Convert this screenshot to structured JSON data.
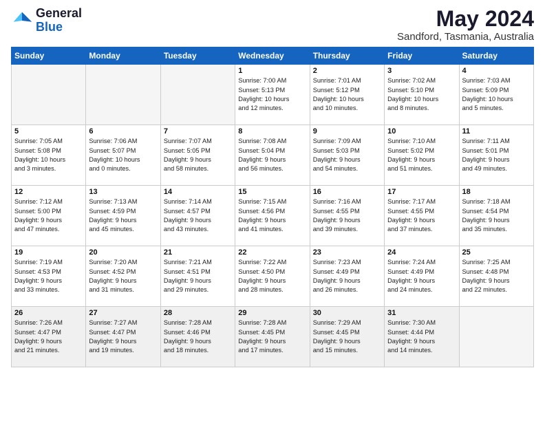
{
  "header": {
    "logo_general": "General",
    "logo_blue": "Blue",
    "month_year": "May 2024",
    "location": "Sandford, Tasmania, Australia"
  },
  "days_of_week": [
    "Sunday",
    "Monday",
    "Tuesday",
    "Wednesday",
    "Thursday",
    "Friday",
    "Saturday"
  ],
  "weeks": [
    [
      {
        "day": "",
        "empty": true,
        "info": ""
      },
      {
        "day": "",
        "empty": true,
        "info": ""
      },
      {
        "day": "",
        "empty": true,
        "info": ""
      },
      {
        "day": "1",
        "empty": false,
        "info": "Sunrise: 7:00 AM\nSunset: 5:13 PM\nDaylight: 10 hours\nand 12 minutes."
      },
      {
        "day": "2",
        "empty": false,
        "info": "Sunrise: 7:01 AM\nSunset: 5:12 PM\nDaylight: 10 hours\nand 10 minutes."
      },
      {
        "day": "3",
        "empty": false,
        "info": "Sunrise: 7:02 AM\nSunset: 5:10 PM\nDaylight: 10 hours\nand 8 minutes."
      },
      {
        "day": "4",
        "empty": false,
        "info": "Sunrise: 7:03 AM\nSunset: 5:09 PM\nDaylight: 10 hours\nand 5 minutes."
      }
    ],
    [
      {
        "day": "5",
        "empty": false,
        "info": "Sunrise: 7:05 AM\nSunset: 5:08 PM\nDaylight: 10 hours\nand 3 minutes."
      },
      {
        "day": "6",
        "empty": false,
        "info": "Sunrise: 7:06 AM\nSunset: 5:07 PM\nDaylight: 10 hours\nand 0 minutes."
      },
      {
        "day": "7",
        "empty": false,
        "info": "Sunrise: 7:07 AM\nSunset: 5:05 PM\nDaylight: 9 hours\nand 58 minutes."
      },
      {
        "day": "8",
        "empty": false,
        "info": "Sunrise: 7:08 AM\nSunset: 5:04 PM\nDaylight: 9 hours\nand 56 minutes."
      },
      {
        "day": "9",
        "empty": false,
        "info": "Sunrise: 7:09 AM\nSunset: 5:03 PM\nDaylight: 9 hours\nand 54 minutes."
      },
      {
        "day": "10",
        "empty": false,
        "info": "Sunrise: 7:10 AM\nSunset: 5:02 PM\nDaylight: 9 hours\nand 51 minutes."
      },
      {
        "day": "11",
        "empty": false,
        "info": "Sunrise: 7:11 AM\nSunset: 5:01 PM\nDaylight: 9 hours\nand 49 minutes."
      }
    ],
    [
      {
        "day": "12",
        "empty": false,
        "info": "Sunrise: 7:12 AM\nSunset: 5:00 PM\nDaylight: 9 hours\nand 47 minutes."
      },
      {
        "day": "13",
        "empty": false,
        "info": "Sunrise: 7:13 AM\nSunset: 4:59 PM\nDaylight: 9 hours\nand 45 minutes."
      },
      {
        "day": "14",
        "empty": false,
        "info": "Sunrise: 7:14 AM\nSunset: 4:57 PM\nDaylight: 9 hours\nand 43 minutes."
      },
      {
        "day": "15",
        "empty": false,
        "info": "Sunrise: 7:15 AM\nSunset: 4:56 PM\nDaylight: 9 hours\nand 41 minutes."
      },
      {
        "day": "16",
        "empty": false,
        "info": "Sunrise: 7:16 AM\nSunset: 4:55 PM\nDaylight: 9 hours\nand 39 minutes."
      },
      {
        "day": "17",
        "empty": false,
        "info": "Sunrise: 7:17 AM\nSunset: 4:55 PM\nDaylight: 9 hours\nand 37 minutes."
      },
      {
        "day": "18",
        "empty": false,
        "info": "Sunrise: 7:18 AM\nSunset: 4:54 PM\nDaylight: 9 hours\nand 35 minutes."
      }
    ],
    [
      {
        "day": "19",
        "empty": false,
        "info": "Sunrise: 7:19 AM\nSunset: 4:53 PM\nDaylight: 9 hours\nand 33 minutes."
      },
      {
        "day": "20",
        "empty": false,
        "info": "Sunrise: 7:20 AM\nSunset: 4:52 PM\nDaylight: 9 hours\nand 31 minutes."
      },
      {
        "day": "21",
        "empty": false,
        "info": "Sunrise: 7:21 AM\nSunset: 4:51 PM\nDaylight: 9 hours\nand 29 minutes."
      },
      {
        "day": "22",
        "empty": false,
        "info": "Sunrise: 7:22 AM\nSunset: 4:50 PM\nDaylight: 9 hours\nand 28 minutes."
      },
      {
        "day": "23",
        "empty": false,
        "info": "Sunrise: 7:23 AM\nSunset: 4:49 PM\nDaylight: 9 hours\nand 26 minutes."
      },
      {
        "day": "24",
        "empty": false,
        "info": "Sunrise: 7:24 AM\nSunset: 4:49 PM\nDaylight: 9 hours\nand 24 minutes."
      },
      {
        "day": "25",
        "empty": false,
        "info": "Sunrise: 7:25 AM\nSunset: 4:48 PM\nDaylight: 9 hours\nand 22 minutes."
      }
    ],
    [
      {
        "day": "26",
        "empty": false,
        "info": "Sunrise: 7:26 AM\nSunset: 4:47 PM\nDaylight: 9 hours\nand 21 minutes."
      },
      {
        "day": "27",
        "empty": false,
        "info": "Sunrise: 7:27 AM\nSunset: 4:47 PM\nDaylight: 9 hours\nand 19 minutes."
      },
      {
        "day": "28",
        "empty": false,
        "info": "Sunrise: 7:28 AM\nSunset: 4:46 PM\nDaylight: 9 hours\nand 18 minutes."
      },
      {
        "day": "29",
        "empty": false,
        "info": "Sunrise: 7:28 AM\nSunset: 4:45 PM\nDaylight: 9 hours\nand 17 minutes."
      },
      {
        "day": "30",
        "empty": false,
        "info": "Sunrise: 7:29 AM\nSunset: 4:45 PM\nDaylight: 9 hours\nand 15 minutes."
      },
      {
        "day": "31",
        "empty": false,
        "info": "Sunrise: 7:30 AM\nSunset: 4:44 PM\nDaylight: 9 hours\nand 14 minutes."
      },
      {
        "day": "",
        "empty": true,
        "info": ""
      }
    ]
  ]
}
